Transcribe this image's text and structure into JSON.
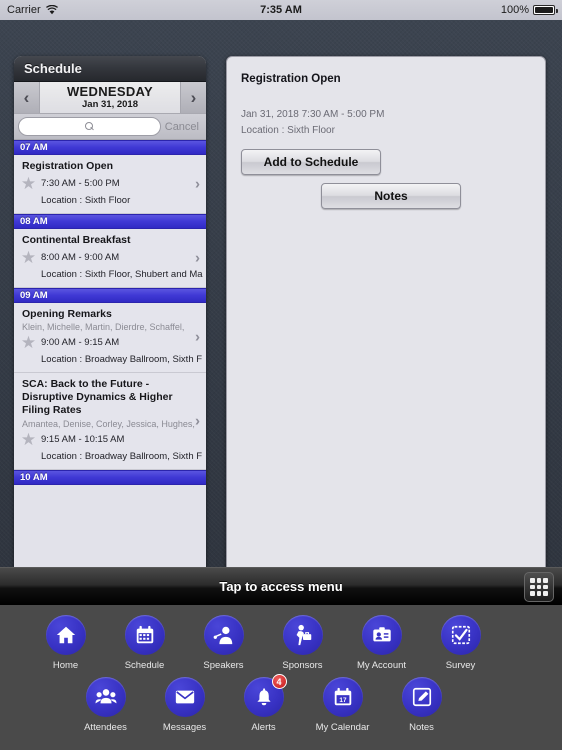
{
  "statusbar": {
    "carrier": "Carrier",
    "time": "7:35 AM",
    "battery": "100%",
    "wifi_icon": "wifi-icon",
    "battery_icon": "battery-icon"
  },
  "schedule": {
    "panel_title": "Schedule",
    "prev_label": "‹",
    "next_label": "›",
    "date_day": "WEDNESDAY",
    "date_sub": "Jan 31, 2018",
    "search_placeholder": "",
    "search_value": "",
    "cancel_label": "Cancel",
    "groups": [
      {
        "hour": "07 AM",
        "events": [
          {
            "title": "Registration Open",
            "speakers": "",
            "time": "7:30 AM - 5:00 PM",
            "location": "Location : Sixth Floor"
          }
        ]
      },
      {
        "hour": "08 AM",
        "events": [
          {
            "title": "Continental Breakfast",
            "speakers": "",
            "time": "8:00 AM - 9:00 AM",
            "location": "Location : Sixth Floor, Shubert and Ma"
          }
        ]
      },
      {
        "hour": "09 AM",
        "events": [
          {
            "title": "Opening Remarks",
            "speakers": "Klein, Michelle, Martin, Dierdre, Schaffel,",
            "time": "9:00 AM - 9:15 AM",
            "location": "Location : Broadway Ballroom, Sixth F"
          },
          {
            "title": "SCA: Back to the Future - Disruptive Dynamics & Higher Filing Rates",
            "speakers": "Amantea, Denise, Corley, Jessica, Hughes,",
            "time": "9:15 AM - 10:15 AM",
            "location": "Location : Broadway Ballroom, Sixth F"
          }
        ]
      },
      {
        "hour": "10 AM",
        "events": []
      }
    ]
  },
  "detail": {
    "title": "Registration Open",
    "datetime": "Jan 31, 2018 7:30 AM - 5:00 PM",
    "location": "Location : Sixth Floor",
    "add_button": "Add to Schedule",
    "notes_button": "Notes"
  },
  "menu_bar": {
    "label": "Tap to access menu",
    "grid_icon": "grid-menu-icon"
  },
  "dock": {
    "row1": [
      {
        "label": "Home",
        "icon": "home-icon"
      },
      {
        "label": "Schedule",
        "icon": "calendar-icon"
      },
      {
        "label": "Speakers",
        "icon": "speaker-person-icon"
      },
      {
        "label": "Sponsors",
        "icon": "briefcase-person-icon"
      },
      {
        "label": "My Account",
        "icon": "id-badge-icon"
      },
      {
        "label": "Survey",
        "icon": "checkbox-icon"
      }
    ],
    "row2": [
      {
        "label": "Attendees",
        "icon": "people-group-icon"
      },
      {
        "label": "Messages",
        "icon": "envelope-icon"
      },
      {
        "label": "Alerts",
        "icon": "bell-icon",
        "badge": "4"
      },
      {
        "label": "My Calendar",
        "icon": "calendar-17-icon"
      },
      {
        "label": "Notes",
        "icon": "pencil-square-icon"
      }
    ]
  },
  "colors": {
    "accent_blue": "#3832c4",
    "hour_header": "#3f38d4",
    "badge_red": "#c41c1c",
    "panel_bg": "#e2e2ea"
  }
}
